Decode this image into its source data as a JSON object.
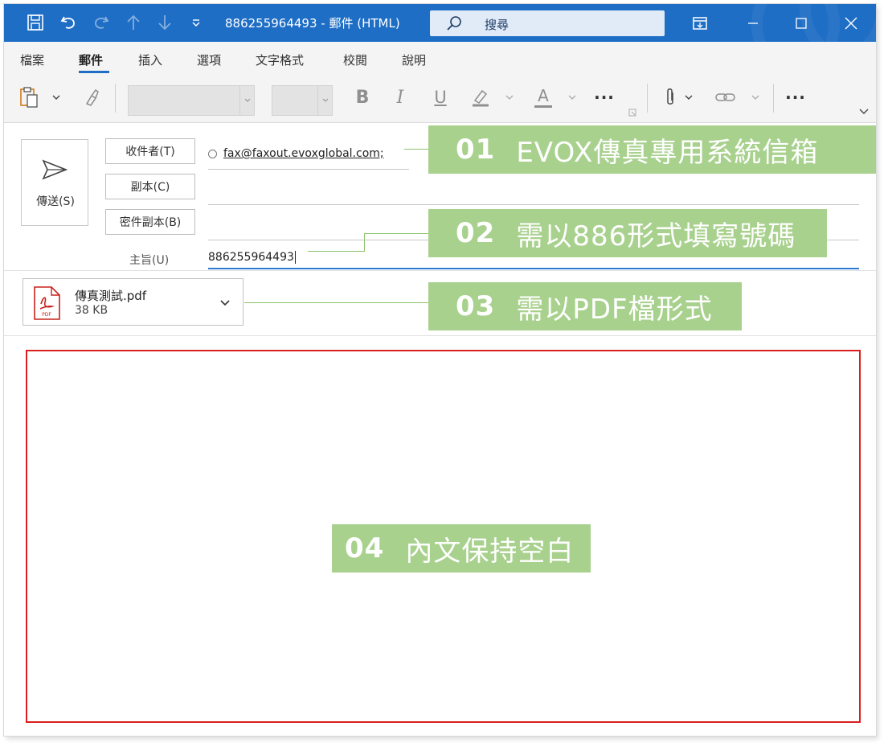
{
  "window": {
    "title": "886255964493 - 郵件 (HTML)",
    "search_placeholder": "搜尋"
  },
  "ribbon": {
    "tabs": [
      "檔案",
      "郵件",
      "插入",
      "選項",
      "文字格式",
      "校閱",
      "說明"
    ],
    "active_tab": "郵件",
    "bold_label": "B",
    "italic_label": "I",
    "underline_label": "U",
    "font_color_label": "A",
    "more_label": "···"
  },
  "compose": {
    "send_label": "傳送(S)",
    "to_label": "收件者(T)",
    "cc_label": "副本(C)",
    "bcc_label": "密件副本(B)",
    "subject_label": "主旨(U)",
    "to_value": "fax@faxout.evoxglobal.com;",
    "subject_value": "886255964493"
  },
  "attachment": {
    "name": "傳真測試.pdf",
    "size": "38 KB",
    "icon_text": "PDF"
  },
  "annotations": [
    {
      "num": "01",
      "text": "EVOX傳真專用系統信箱"
    },
    {
      "num": "02",
      "text": "需以886形式填寫號碼"
    },
    {
      "num": "03",
      "text": "需以PDF檔形式"
    },
    {
      "num": "04",
      "text": "內文保持空白"
    }
  ],
  "colors": {
    "titlebar": "#1f6ec6",
    "callout": "#a9d18e",
    "body_border": "#d91e1e",
    "subject_underline": "#2d7ad4"
  }
}
